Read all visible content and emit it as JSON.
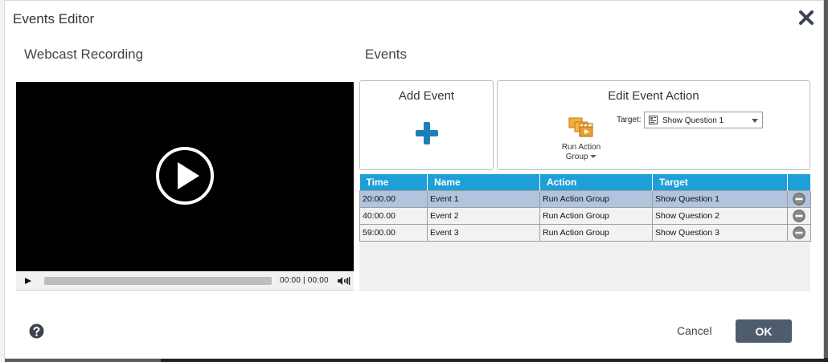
{
  "dialog": {
    "title": "Events Editor",
    "close_icon": "close-icon"
  },
  "webcast": {
    "label": "Webcast Recording",
    "player": {
      "time": "00:00 | 00:00",
      "progress_fraction": 0.0,
      "play_icon": "play-icon",
      "volume_icon": "volume-icon"
    }
  },
  "events": {
    "label": "Events",
    "add_event": {
      "title": "Add Event",
      "icon": "plus-icon"
    },
    "edit_action": {
      "title": "Edit Event Action",
      "action_button_line1": "Run Action",
      "action_button_line2": "Group",
      "action_icon": "clapperboard-group-icon",
      "target_label": "Target:",
      "target_value": "Show Question 1"
    },
    "table": {
      "columns": [
        "Time",
        "Name",
        "Action",
        "Target"
      ],
      "rows": [
        {
          "time": "20:00.00",
          "name": "Event 1",
          "action": "Run Action Group",
          "target": "Show Question 1",
          "selected": true
        },
        {
          "time": "40:00.00",
          "name": "Event 2",
          "action": "Run Action Group",
          "target": "Show Question 2",
          "selected": false
        },
        {
          "time": "59:00.00",
          "name": "Event 3",
          "action": "Run Action Group",
          "target": "Show Question 3",
          "selected": false
        }
      ]
    }
  },
  "footer": {
    "help_icon": "help-icon",
    "cancel_label": "Cancel",
    "ok_label": "OK"
  },
  "colors": {
    "table_header": "#1f9fd8",
    "selected_row": "#b0c4de",
    "ok_button": "#4f5b6e",
    "plus_icon": "#1d7fb8"
  }
}
